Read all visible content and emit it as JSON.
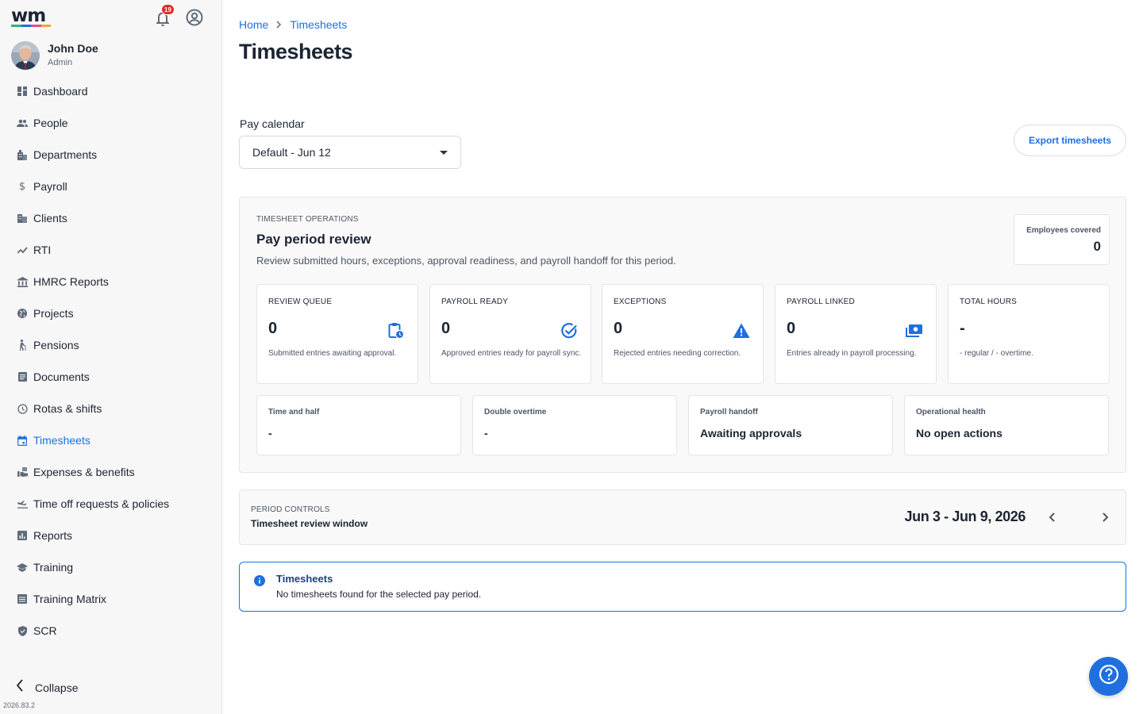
{
  "app": {
    "logo_text": "wm"
  },
  "header": {
    "notifications_count": "19"
  },
  "user": {
    "name": "John Doe",
    "role": "Admin"
  },
  "sidebar": {
    "items": [
      {
        "label": "Dashboard",
        "icon": "dashboard-icon"
      },
      {
        "label": "People",
        "icon": "people-icon"
      },
      {
        "label": "Departments",
        "icon": "building-icon"
      },
      {
        "label": "Payroll",
        "icon": "dollar-icon"
      },
      {
        "label": "Clients",
        "icon": "business-icon"
      },
      {
        "label": "RTI",
        "icon": "trend-icon"
      },
      {
        "label": "HMRC Reports",
        "icon": "bank-icon"
      },
      {
        "label": "Projects",
        "icon": "globe-icon"
      },
      {
        "label": "Pensions",
        "icon": "elderly-icon"
      },
      {
        "label": "Documents",
        "icon": "document-icon"
      },
      {
        "label": "Rotas & shifts",
        "icon": "clock-icon"
      },
      {
        "label": "Timesheets",
        "icon": "calendar-icon",
        "active": true
      },
      {
        "label": "Expenses & benefits",
        "icon": "receipt-icon"
      },
      {
        "label": "Time off requests & policies",
        "icon": "flight-icon"
      },
      {
        "label": "Reports",
        "icon": "report-icon"
      },
      {
        "label": "Training",
        "icon": "school-icon"
      },
      {
        "label": "Training Matrix",
        "icon": "matrix-icon"
      },
      {
        "label": "SCR",
        "icon": "shield-icon"
      }
    ],
    "collapse_label": "Collapse",
    "version": "2026.83.2"
  },
  "breadcrumb": {
    "home": "Home",
    "current": "Timesheets"
  },
  "page": {
    "title": "Timesheets"
  },
  "pay_calendar": {
    "label": "Pay calendar",
    "selected": "Default - Jun 12"
  },
  "export_button": "Export timesheets",
  "operations": {
    "eyebrow": "TIMESHEET OPERATIONS",
    "title": "Pay period review",
    "description": "Review submitted hours, exceptions, approval readiness, and payroll handoff for this period.",
    "employees_covered": {
      "label": "Employees covered",
      "value": "0"
    },
    "metrics": [
      {
        "title": "REVIEW QUEUE",
        "value": "0",
        "desc": "Submitted entries awaiting approval.",
        "icon": "clipboard-clock-icon"
      },
      {
        "title": "PAYROLL READY",
        "value": "0",
        "desc": "Approved entries ready for payroll sync.",
        "icon": "check-circle-icon"
      },
      {
        "title": "EXCEPTIONS",
        "value": "0",
        "desc": "Rejected entries needing correction.",
        "icon": "warning-icon"
      },
      {
        "title": "PAYROLL LINKED",
        "value": "0",
        "desc": "Entries already in payroll processing.",
        "icon": "payments-icon"
      },
      {
        "title": "TOTAL HOURS",
        "value": "-",
        "desc": "- regular / - overtime."
      }
    ],
    "stats": [
      {
        "title": "Time and half",
        "value": "-"
      },
      {
        "title": "Double overtime",
        "value": "-"
      },
      {
        "title": "Payroll handoff",
        "value": "Awaiting approvals"
      },
      {
        "title": "Operational health",
        "value": "No open actions"
      }
    ]
  },
  "period_controls": {
    "eyebrow": "PERIOD CONTROLS",
    "title": "Timesheet review window",
    "range": "Jun 3 - Jun 9, 2026"
  },
  "alert": {
    "title": "Timesheets",
    "message": "No timesheets found for the selected pay period."
  },
  "colors": {
    "accent": "#1f6fe0",
    "badge": "#e32a2a",
    "sidebar_bg": "#f7f7f7"
  }
}
